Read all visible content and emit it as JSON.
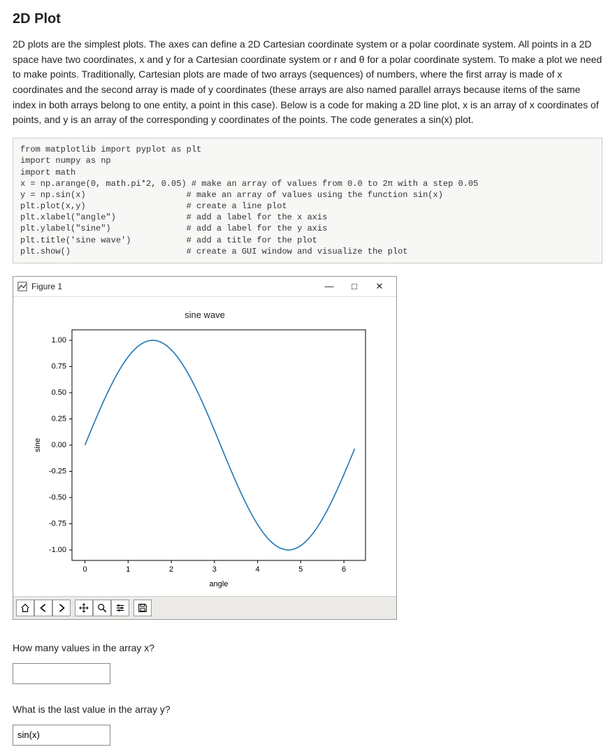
{
  "header": {
    "title": "2D Plot"
  },
  "prose": {
    "para1": "2D plots are the simplest plots. The axes can define a 2D Cartesian coordinate system or a polar coordinate system. All points in a 2D space have two coordinates, x and y for a Cartesian coordinate system or r and θ  for a polar coordinate system. To make a plot we need to make points. Traditionally, Cartesian plots are made of two arrays (sequences) of numbers, where the first array is made of x coordinates and the second array is made of y coordinates (these arrays are also named parallel arrays because items of the same index in both arrays belong to one entity, a point in this case). Below is a code for making a 2D line plot, x is an array of x coordinates of points, and y is an array of the corresponding y coordinates of the points.  The code generates a sin(x) plot."
  },
  "code": "from matplotlib import pyplot as plt\nimport numpy as np\nimport math\nx = np.arange(0, math.pi*2, 0.05) # make an array of values from 0.0 to 2π with a step 0.05\ny = np.sin(x)                    # make an array of values using the function sin(x)\nplt.plot(x,y)                    # create a line plot\nplt.xlabel(\"angle\")              # add a label for the x axis\nplt.ylabel(\"sine\")               # add a label for the y axis\nplt.title('sine wave')           # add a title for the plot\nplt.show()                       # create a GUI window and visualize the plot",
  "figure": {
    "window_title": "Figure 1",
    "minimize": "—",
    "maximize": "□",
    "close": "✕"
  },
  "chart_data": {
    "type": "line",
    "title": "sine wave",
    "xlabel": "angle",
    "ylabel": "sine",
    "xlim": [
      -0.3,
      6.5
    ],
    "ylim": [
      -1.1,
      1.1
    ],
    "xticks": [
      0,
      1,
      2,
      3,
      4,
      5,
      6
    ],
    "yticks": [
      -1.0,
      -0.75,
      -0.5,
      -0.25,
      0.0,
      0.25,
      0.5,
      0.75,
      1.0
    ],
    "series": [
      {
        "name": "sin(x)",
        "function": "sin",
        "x_start": 0.0,
        "x_end": 6.2832,
        "x_step": 0.05,
        "color": "#1f77b4"
      }
    ]
  },
  "toolbar": {
    "home": "⌂",
    "back": "←",
    "forward": "→",
    "pan": "✥",
    "zoom": "🔍",
    "configure": "☰",
    "save": "💾"
  },
  "questions": {
    "q1": "How many values in the array x?",
    "q1_value": "",
    "q2": "What is the last value in the array y?",
    "q2_value": "sin(x)"
  }
}
